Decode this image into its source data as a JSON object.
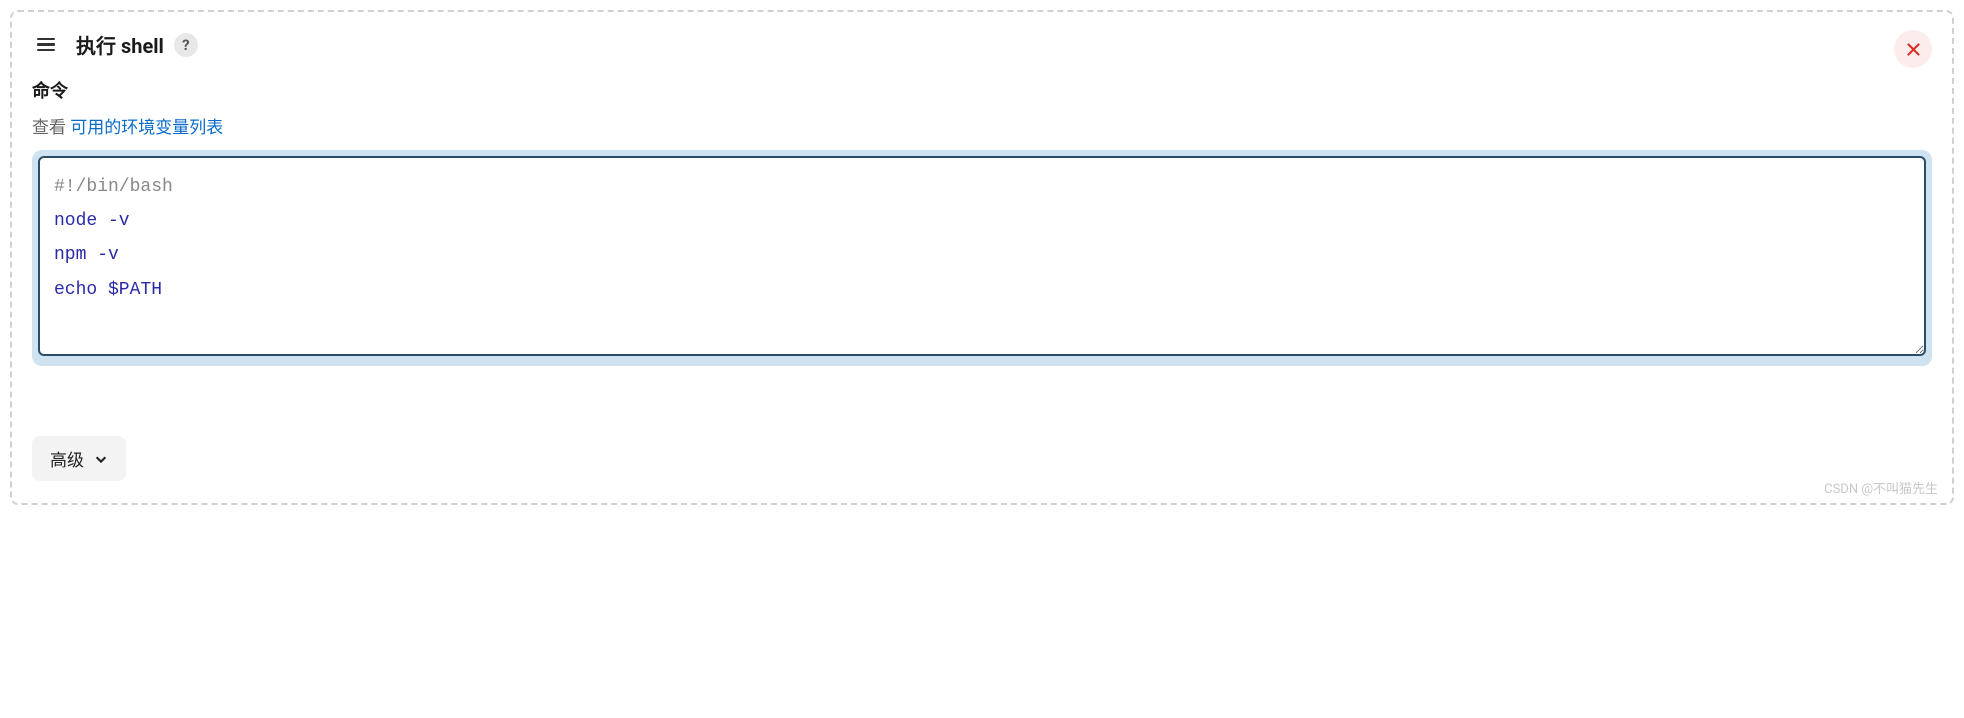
{
  "header": {
    "title": "执行 shell",
    "help_symbol": "?"
  },
  "command": {
    "label": "命令",
    "hint_prefix": "查看 ",
    "hint_link": "可用的环境变量列表",
    "script": "#!/bin/bash\nnode -v\nnpm -v\necho $PATH\n"
  },
  "advanced": {
    "label": "高级"
  },
  "watermark": "CSDN @不叫猫先生"
}
